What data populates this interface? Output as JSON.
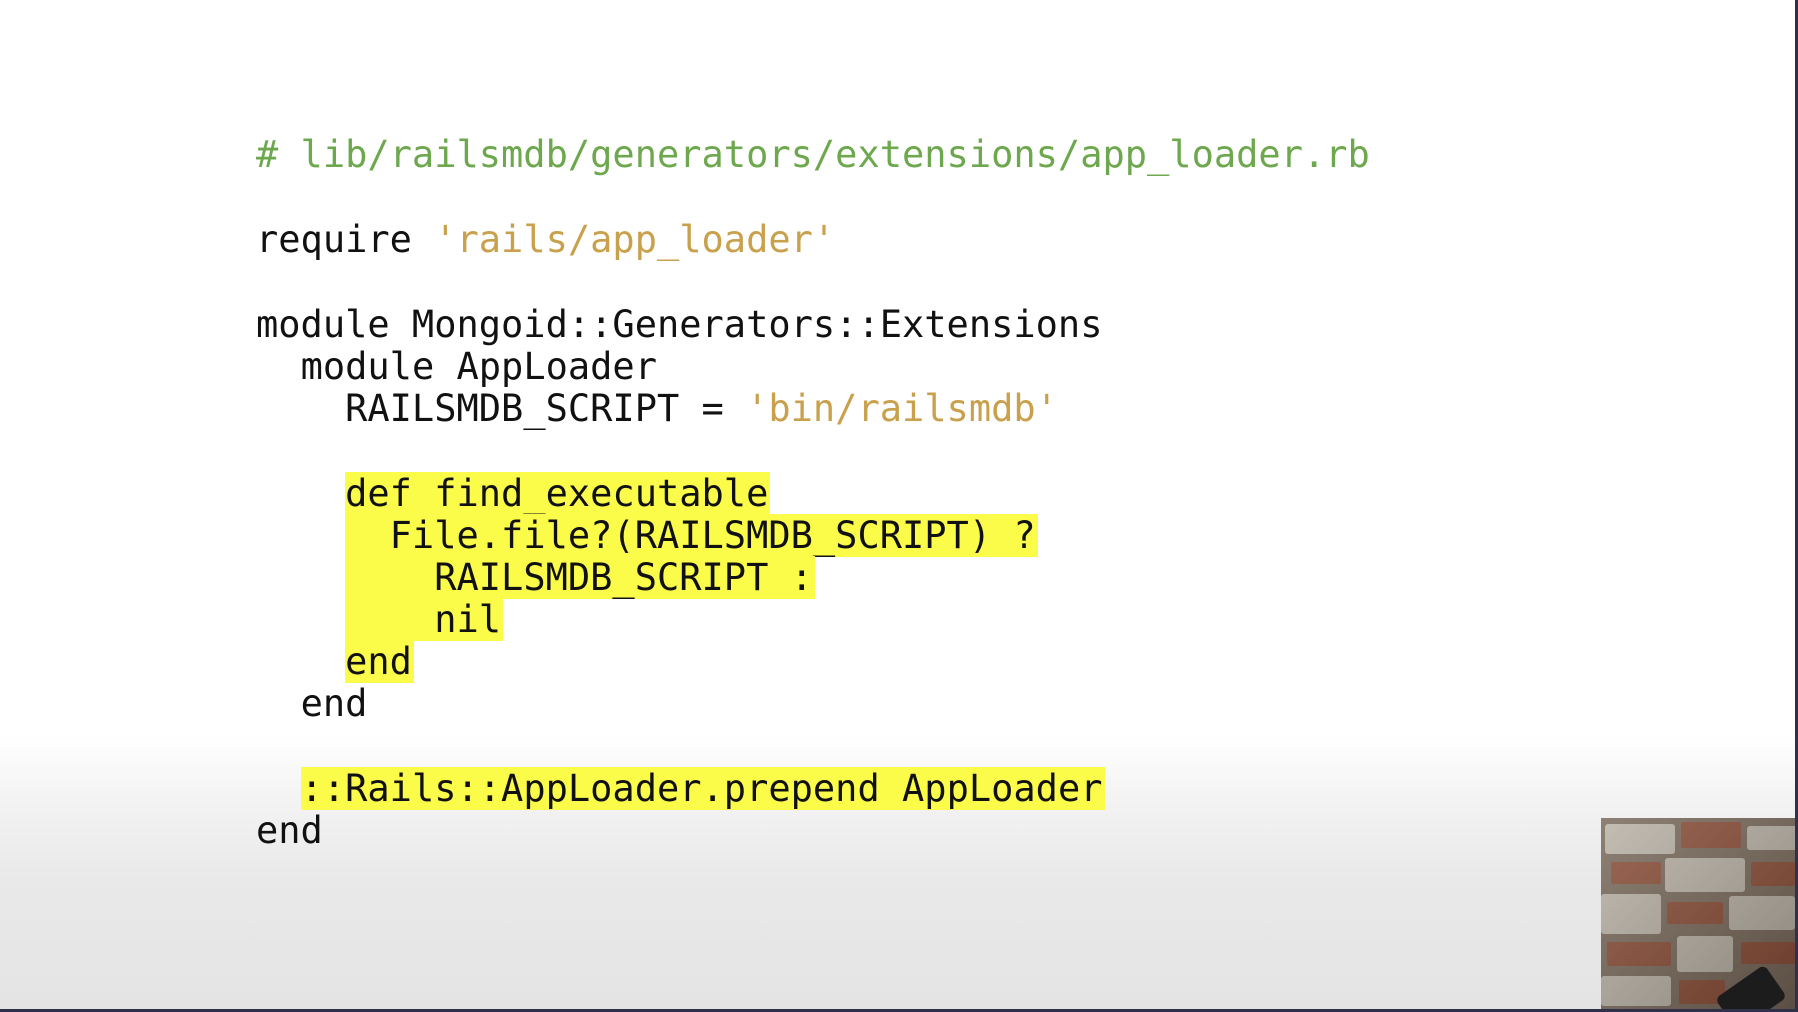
{
  "slide": {
    "code_lines": [
      {
        "indent": "",
        "segments": [
          {
            "kind": "comment",
            "text": "# lib/railsmdb/generators/extensions/app_loader.rb"
          }
        ]
      },
      {
        "indent": "",
        "segments": [
          {
            "kind": "plain",
            "text": "require "
          },
          {
            "kind": "string",
            "text": "'rails/app_loader'"
          }
        ]
      },
      {
        "indent": "",
        "segments": [
          {
            "kind": "plain",
            "text": "module Mongoid::Generators::Extensions"
          }
        ]
      },
      {
        "indent": "  ",
        "segments": [
          {
            "kind": "plain",
            "text": "module AppLoader"
          }
        ]
      },
      {
        "indent": "    ",
        "segments": [
          {
            "kind": "plain",
            "text": "RAILSMDB_SCRIPT = "
          },
          {
            "kind": "string",
            "text": "'bin/railsmdb'"
          }
        ]
      },
      {
        "indent": "    ",
        "highlight": true,
        "segments": [
          {
            "kind": "plain",
            "text": "def find_executable"
          }
        ]
      },
      {
        "indent": "    ",
        "highlight": true,
        "segments": [
          {
            "kind": "plain",
            "text": "  File.file?(RAILSMDB_SCRIPT) ?"
          }
        ]
      },
      {
        "indent": "    ",
        "highlight": true,
        "segments": [
          {
            "kind": "plain",
            "text": "    RAILSMDB_SCRIPT :"
          }
        ]
      },
      {
        "indent": "    ",
        "highlight": true,
        "segments": [
          {
            "kind": "plain",
            "text": "    nil"
          }
        ]
      },
      {
        "indent": "    ",
        "highlight": true,
        "segments": [
          {
            "kind": "plain",
            "text": "end"
          }
        ]
      },
      {
        "indent": "  ",
        "segments": [
          {
            "kind": "plain",
            "text": "end"
          }
        ]
      },
      {
        "indent": "  ",
        "highlight": true,
        "segments": [
          {
            "kind": "plain",
            "text": "::Rails::AppLoader.prepend AppLoader"
          }
        ]
      },
      {
        "indent": "",
        "segments": [
          {
            "kind": "plain",
            "text": "end"
          }
        ]
      }
    ]
  },
  "colors": {
    "comment": "#6ea84e",
    "string": "#c9a14d",
    "highlight": "#fbfb4a",
    "text": "#111111"
  },
  "webcam": {
    "icon": "presenter-webcam-icon"
  }
}
